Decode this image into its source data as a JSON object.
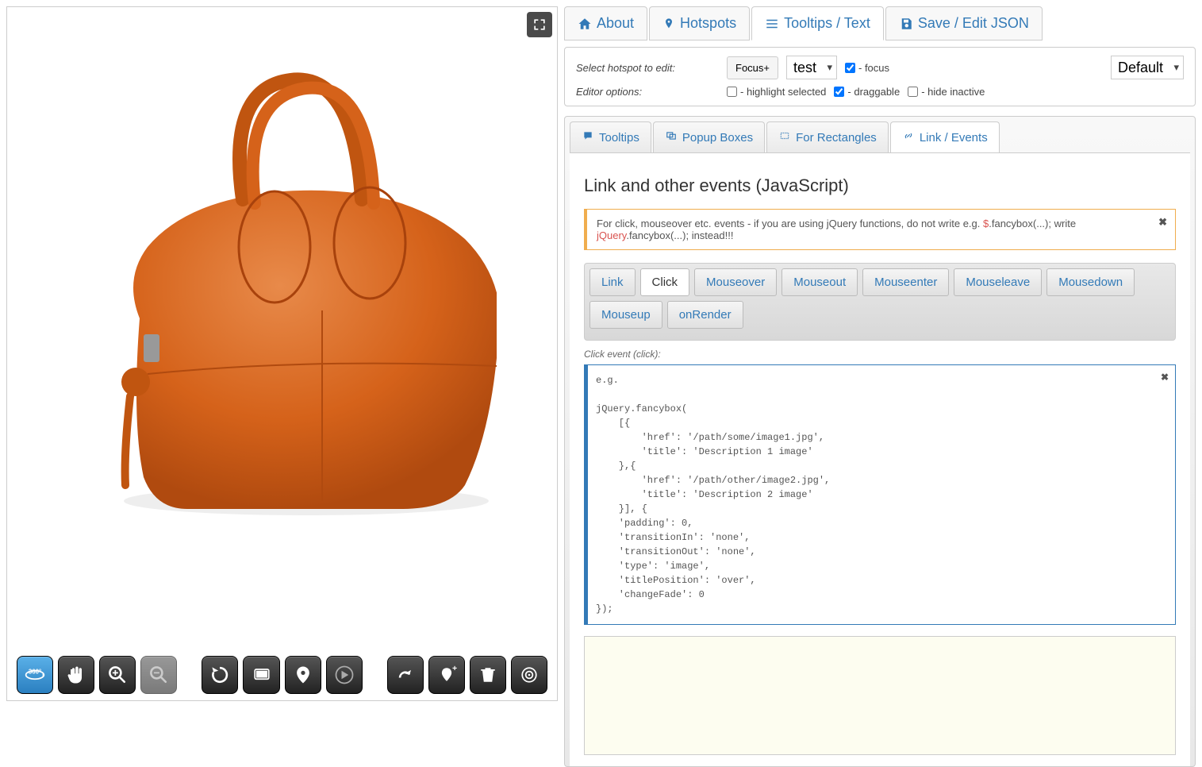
{
  "mainTabs": {
    "about": "About",
    "hotspots": "Hotspots",
    "tooltips": "Tooltips / Text",
    "save": "Save / Edit JSON"
  },
  "editor": {
    "selectLabel": "Select hotspot to edit:",
    "focusBtn": "Focus+",
    "testSelect": "test",
    "focusChk": "- focus",
    "defaultSelect": "Default",
    "optionsLabel": "Editor options:",
    "highlightChk": "- highlight selected",
    "draggableChk": "- draggable",
    "hideChk": "- hide inactive"
  },
  "subTabs": {
    "tooltips": "Tooltips",
    "popup": "Popup Boxes",
    "rectangles": "For Rectangles",
    "link": "Link / Events"
  },
  "section": {
    "title": "Link and other events (JavaScript)"
  },
  "alert": {
    "part1": "For click, mouseover etc. events - if you are using jQuery functions, do not write e.g. ",
    "red1": "$",
    "part2": ".fancybox(...); write ",
    "red2": "jQuery",
    "part3": ".fancybox(...); instead!!!"
  },
  "eventTabs": {
    "link": "Link",
    "click": "Click",
    "mouseover": "Mouseover",
    "mouseout": "Mouseout",
    "mouseenter": "Mouseenter",
    "mouseleave": "Mouseleave",
    "mousedown": "Mousedown",
    "mouseup": "Mouseup",
    "onrender": "onRender"
  },
  "eventLabel": "Click event (click):",
  "codeExample": {
    "eg": "e.g.",
    "body": "jQuery.fancybox(\n    [{\n        'href': '/path/some/image1.jpg',\n        'title': 'Description 1 image'\n    },{\n        'href': '/path/other/image2.jpg',\n        'title': 'Description 2 image'\n    }], {\n    'padding': 0,\n    'transitionIn': 'none',\n    'transitionOut': 'none',\n    'type': 'image',\n    'titlePosition': 'over',\n    'changeFade': 0\n});"
  },
  "toolbar": {
    "rotate360": "360",
    "pan": "pan",
    "zoomIn": "zoom-in",
    "zoomOut": "zoom-out",
    "reset": "reset",
    "fullscreen": "fullscreen",
    "marker": "marker",
    "play": "play",
    "redo": "redo",
    "addPin": "add-pin",
    "delete": "delete",
    "target": "target"
  }
}
